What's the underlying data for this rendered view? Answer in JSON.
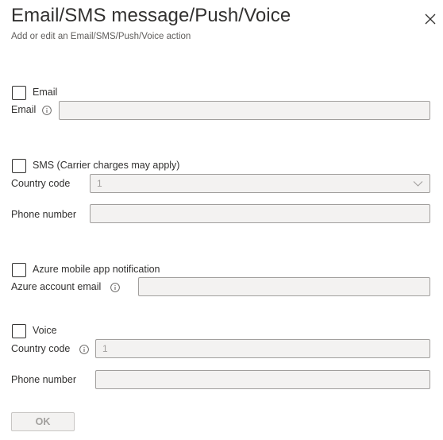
{
  "header": {
    "title": "Email/SMS message/Push/Voice",
    "subtitle": "Add or edit an Email/SMS/Push/Voice action"
  },
  "email": {
    "checkbox_label": "Email",
    "field_label": "Email",
    "value": ""
  },
  "sms": {
    "checkbox_label": "SMS (Carrier charges may apply)",
    "country_label": "Country code",
    "country_value": "1",
    "phone_label": "Phone number",
    "phone_value": ""
  },
  "push": {
    "checkbox_label": "Azure mobile app notification",
    "field_label": "Azure account email",
    "value": ""
  },
  "voice": {
    "checkbox_label": "Voice",
    "country_label": "Country code",
    "country_value": "1",
    "phone_label": "Phone number",
    "phone_value": ""
  },
  "footer": {
    "ok_label": "OK"
  },
  "colors": {
    "text": "#323130",
    "muted": "#605e5c",
    "disabled_bg": "#f3f2f1",
    "disabled_border": "#a19f9d"
  },
  "icons": {
    "close": "close-icon",
    "info": "info-icon",
    "chevron": "chevron-down-icon"
  }
}
